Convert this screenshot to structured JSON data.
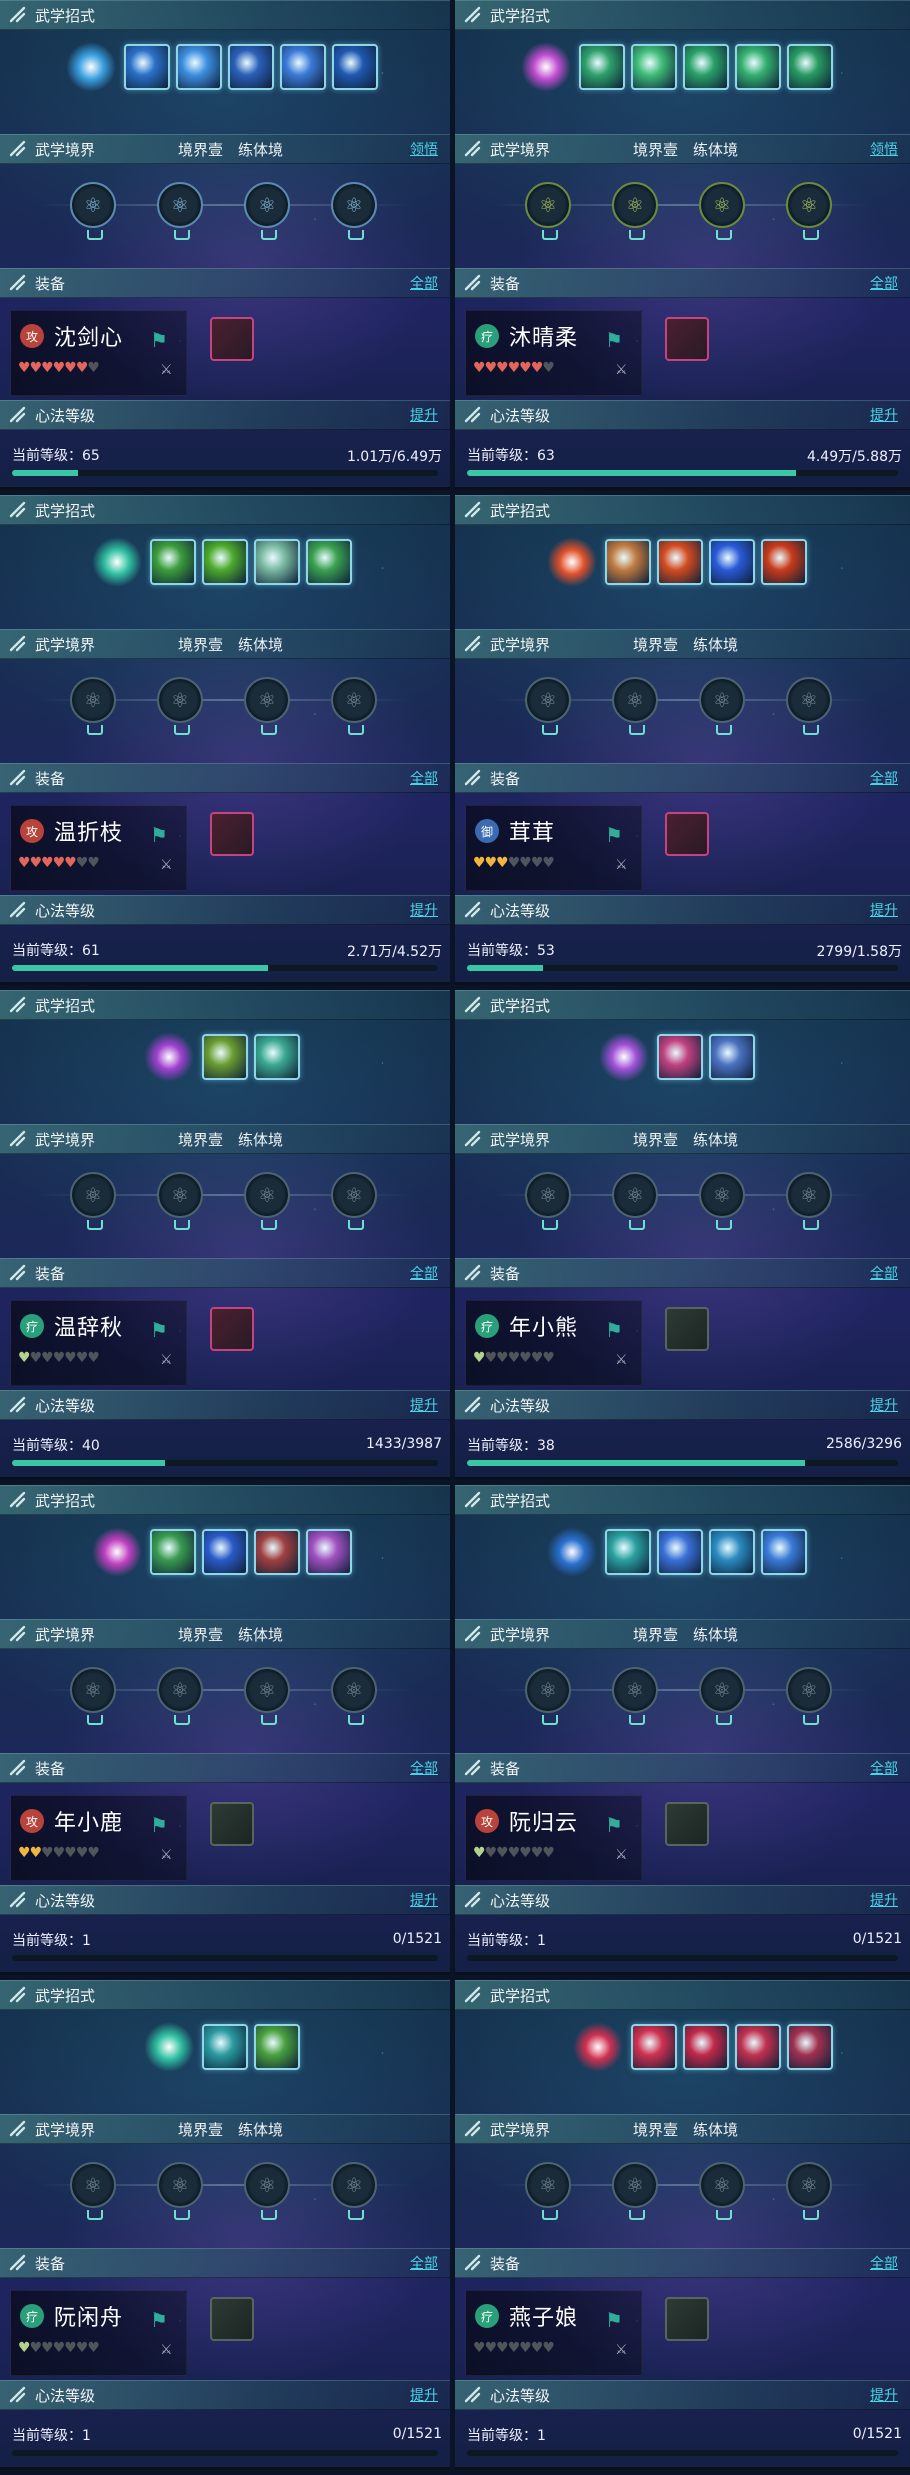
{
  "labels": {
    "skills_header": "武学招式",
    "realm_header": "武学境界",
    "equip_header": "装备",
    "heart_header": "心法等级",
    "all_link": "全部",
    "upgrade_link": "提升",
    "level_prefix": "当前等级：",
    "realm_stage": "境界壹",
    "realm_type": "练体境"
  },
  "colors": {
    "accent": "#47d6e6",
    "exp_fill": "#39c7a8",
    "heart_red": "#e2665c",
    "heart_gold": "#f0b640",
    "heart_green": "#b5d28a"
  },
  "characters": [
    {
      "name": "沈剑心",
      "role_icon": "攻",
      "role_color": "#b8433a",
      "realm_link": "领悟",
      "level": "65",
      "exp": "1.01万/6.49万",
      "exp_frac": 0.156,
      "hearts": [
        "r",
        "r",
        "r",
        "r",
        "r",
        "r",
        "o"
      ],
      "equip": true,
      "skill_count": 6,
      "main_color": "#3aa0e0",
      "skill_colors": [
        "#2a70c8",
        "#3c8ee0",
        "#2a5fb8",
        "#3b7ad8",
        "#1f58b0"
      ],
      "realm_theme": "blue"
    },
    {
      "name": "沐晴柔",
      "role_icon": "疗",
      "role_color": "#2aa07a",
      "realm_link": "领悟",
      "level": "63",
      "exp": "4.49万/5.88万",
      "exp_frac": 0.764,
      "hearts": [
        "r",
        "r",
        "r",
        "r",
        "r",
        "r",
        "o"
      ],
      "equip": true,
      "skill_count": 6,
      "main_color": "#c04cd0",
      "skill_colors": [
        "#2ea06a",
        "#3ebc78",
        "#2aa068",
        "#34b070",
        "#279a62"
      ],
      "realm_theme": "green"
    },
    {
      "name": "温折枝",
      "role_icon": "攻",
      "role_color": "#b8433a",
      "realm_link": "",
      "level": "61",
      "exp": "2.71万/4.52万",
      "exp_frac": 0.6,
      "hearts": [
        "r",
        "r",
        "r",
        "r",
        "r",
        "o",
        "o"
      ],
      "equip": true,
      "skill_count": 5,
      "main_color": "#30c0a0",
      "skill_colors": [
        "#3c9c3c",
        "#4caa2c",
        "#78b8a0",
        "#3aa050"
      ],
      "realm_theme": "dark"
    },
    {
      "name": "茸茸",
      "role_icon": "御",
      "role_color": "#3a6ab0",
      "realm_link": "",
      "level": "53",
      "exp": "2799/1.58万",
      "exp_frac": 0.177,
      "hearts": [
        "g",
        "g",
        "g",
        "o",
        "o",
        "o",
        "o"
      ],
      "equip": true,
      "skill_count": 5,
      "main_color": "#e0502a",
      "skill_colors": [
        "#c07a40",
        "#d44a20",
        "#2a5ad8",
        "#c83a1a"
      ],
      "realm_theme": "dark"
    },
    {
      "name": "温辞秋",
      "role_icon": "疗",
      "role_color": "#2aa07a",
      "realm_link": "",
      "level": "40",
      "exp": "1433/3987",
      "exp_frac": 0.359,
      "hearts": [
        "e",
        "o",
        "o",
        "o",
        "o",
        "o",
        "o"
      ],
      "equip": true,
      "skill_count": 3,
      "main_color": "#a040d0",
      "skill_colors": [
        "#6a9c30",
        "#3aa890"
      ],
      "realm_theme": "dark"
    },
    {
      "name": "年小熊",
      "role_icon": "疗",
      "role_color": "#2aa07a",
      "realm_link": "",
      "level": "38",
      "exp": "2586/3296",
      "exp_frac": 0.785,
      "hearts": [
        "e",
        "o",
        "o",
        "o",
        "o",
        "o",
        "o"
      ],
      "equip": false,
      "skill_count": 3,
      "main_color": "#a050d8",
      "skill_colors": [
        "#c04080",
        "#4a70c0"
      ],
      "realm_theme": "dark"
    },
    {
      "name": "年小鹿",
      "role_icon": "攻",
      "role_color": "#b8433a",
      "realm_link": "",
      "level": "1",
      "exp": "0/1521",
      "exp_frac": 0,
      "hearts": [
        "g",
        "g",
        "o",
        "o",
        "o",
        "o",
        "o"
      ],
      "equip": false,
      "skill_count": 5,
      "main_color": "#c040c0",
      "skill_colors": [
        "#3a9a50",
        "#2a5ac8",
        "#a04040",
        "#a050c0"
      ],
      "realm_theme": "dark"
    },
    {
      "name": "阮归云",
      "role_icon": "攻",
      "role_color": "#b8433a",
      "realm_link": "",
      "level": "1",
      "exp": "0/1521",
      "exp_frac": 0,
      "hearts": [
        "h",
        "o",
        "o",
        "o",
        "o",
        "o",
        "o"
      ],
      "equip": false,
      "skill_count": 5,
      "main_color": "#2a70d0",
      "skill_colors": [
        "#2aa0a0",
        "#3a70d8",
        "#2a8ac0",
        "#3a7ad8"
      ],
      "realm_theme": "dark"
    },
    {
      "name": "阮闲舟",
      "role_icon": "疗",
      "role_color": "#2aa07a",
      "realm_link": "",
      "level": "1",
      "exp": "0/1521",
      "exp_frac": 0,
      "hearts": [
        "h",
        "o",
        "o",
        "o",
        "o",
        "o",
        "o"
      ],
      "equip": false,
      "skill_count": 3,
      "main_color": "#30c0a0",
      "skill_colors": [
        "#2a9aa0",
        "#4aa040"
      ],
      "realm_theme": "dark"
    },
    {
      "name": "燕子娘",
      "role_icon": "疗",
      "role_color": "#2aa07a",
      "realm_link": "",
      "level": "1",
      "exp": "0/1521",
      "exp_frac": 0,
      "hearts": [
        "o",
        "o",
        "o",
        "o",
        "o",
        "o",
        "o"
      ],
      "equip": false,
      "skill_count": 4,
      "main_color": "#d03050",
      "skill_colors": [
        "#d03050",
        "#c02848",
        "#c03050",
        "#a03050"
      ],
      "realm_theme": "dark"
    }
  ]
}
